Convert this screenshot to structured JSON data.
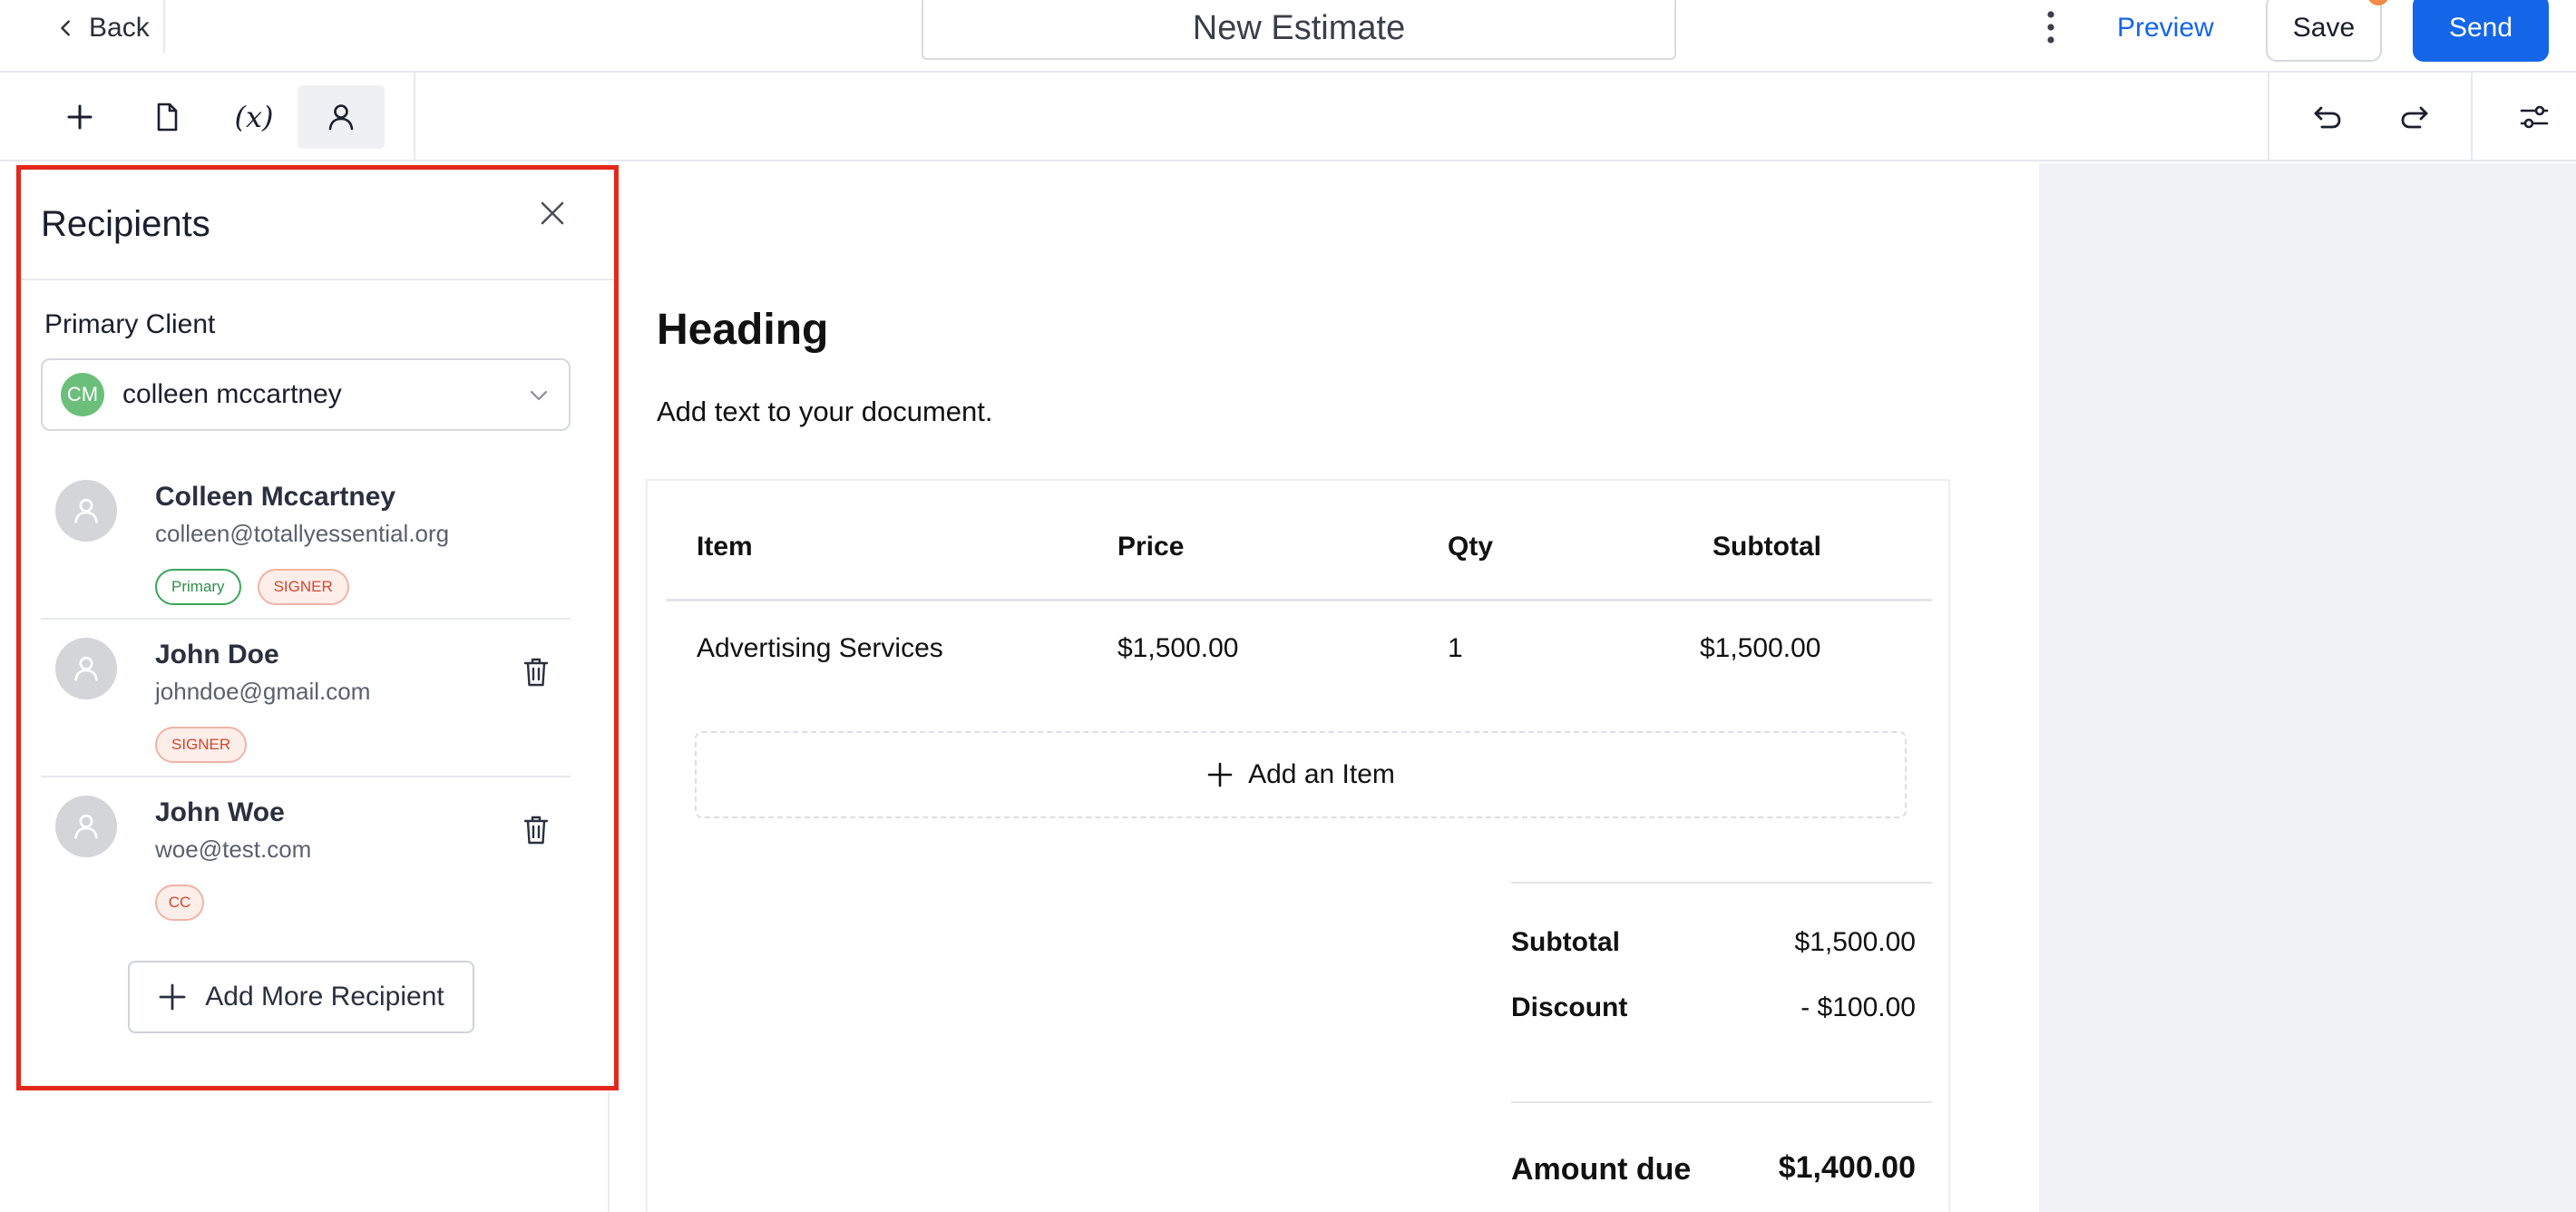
{
  "header": {
    "back_label": "Back",
    "document_title": "New Estimate",
    "preview_label": "Preview",
    "save_label": "Save",
    "send_label": "Send"
  },
  "toolbar": {
    "tools": [
      {
        "name": "add",
        "icon": "plus-icon"
      },
      {
        "name": "document",
        "icon": "file-icon"
      },
      {
        "name": "variables",
        "icon": "variable-icon",
        "text": "(x)"
      },
      {
        "name": "recipients",
        "icon": "user-icon",
        "active": true
      }
    ],
    "right_tools": [
      "undo-icon",
      "redo-icon",
      "settings-sliders-icon"
    ]
  },
  "recipients_panel": {
    "title": "Recipients",
    "primary_client_label": "Primary Client",
    "primary_client": {
      "initials": "CM",
      "name": "colleen mccartney"
    },
    "recipients": [
      {
        "name": "Colleen Mccartney",
        "email": "colleen@totallyessential.org",
        "badges": [
          "Primary",
          "SIGNER"
        ]
      },
      {
        "name": "John Doe",
        "email": "johndoe@gmail.com",
        "badges": [
          "SIGNER"
        ]
      },
      {
        "name": "John Woe",
        "email": "woe@test.com",
        "badges": [
          "CC"
        ]
      }
    ],
    "add_more_label": "Add More Recipient"
  },
  "document": {
    "heading": "Heading",
    "body_text": "Add text to your document.",
    "table": {
      "columns": [
        "Item",
        "Price",
        "Qty",
        "Subtotal"
      ],
      "rows": [
        {
          "item": "Advertising Services",
          "price": "$1,500.00",
          "qty": "1",
          "subtotal": "$1,500.00"
        }
      ],
      "add_item_label": "Add an Item"
    },
    "summary": {
      "subtotal_label": "Subtotal",
      "subtotal_value": "$1,500.00",
      "discount_label": "Discount",
      "discount_value": "- $100.00",
      "amount_due_label": "Amount due",
      "amount_due_value": "$1,400.00"
    }
  },
  "colors": {
    "accent": "#1565e8",
    "panel_highlight": "#e4281b",
    "primary_badge": "#3aa65a",
    "signer_badge": "#d8452c",
    "avatar_green": "#6bbf7a"
  }
}
